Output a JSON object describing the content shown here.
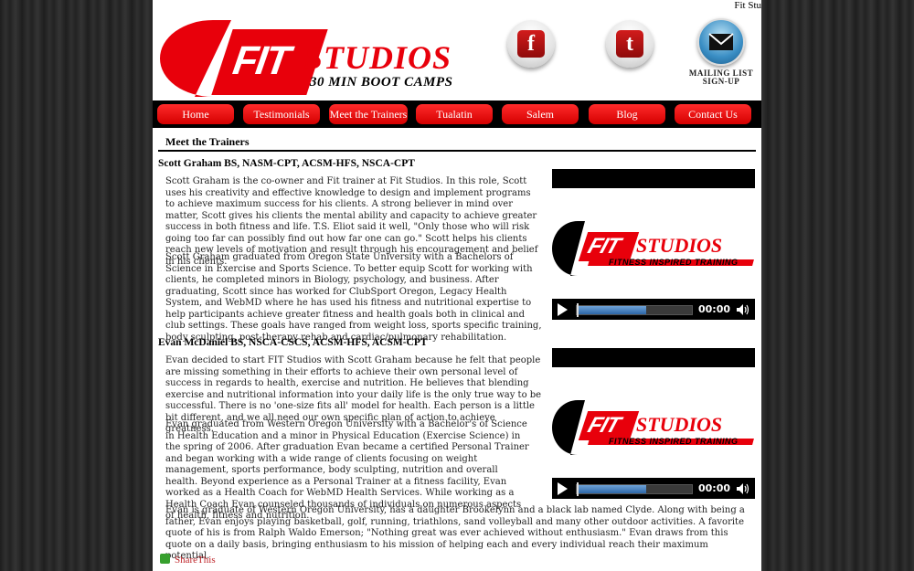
{
  "site": {
    "corner_text": "Fit Stu"
  },
  "header": {
    "logo_fit": "FIT",
    "logo_studios": "STUDIOS",
    "logo_tagline": "30 MIN BOOT CAMPS",
    "social": [
      {
        "name": "facebook",
        "glyph": "f",
        "icon": "facebook-icon"
      },
      {
        "name": "twitter",
        "glyph": "t",
        "icon": "twitter-icon"
      }
    ],
    "mailing_line1": "MAILING LIST",
    "mailing_line2": "SIGN-UP"
  },
  "nav": {
    "items": [
      {
        "label": "Home"
      },
      {
        "label": "Testimonials"
      },
      {
        "label": "Meet the Trainers"
      },
      {
        "label": "Tualatin"
      },
      {
        "label": "Salem"
      },
      {
        "label": "Blog"
      },
      {
        "label": "Contact Us"
      }
    ]
  },
  "content": {
    "page_title": "Meet the Trainers",
    "trainers": [
      {
        "name": "Scott Graham BS, NASM-CPT, ACSM-HFS, NSCA-CPT",
        "paragraphs": [
          "Scott Graham is the co-owner and Fit trainer at Fit Studios. In this role, Scott uses his creativity and effective knowledge to design and implement programs to achieve maximum success for his clients. A strong believer in mind over matter, Scott gives his clients the mental ability and capacity to achieve greater success in both fitness and life. T.S. Eliot said it well, \"Only those who will risk going too far can possibly find out how far one can go.\" Scott helps his clients reach new levels of motivation and result through his encouragement and belief in his clients.",
          "Scott Graham graduated from Oregon State University with a Bachelors of Science in Exercise and Sports Science. To better equip Scott for working with clients, he completed minors in Biology, psychology, and business. After graduating, Scott since has worked for ClubSport Oregon, Legacy Health System, and WebMD where he has used his fitness and nutritional expertise to help participants achieve greater fitness and health goals both in clinical and club settings. These goals have ranged from weight loss, sports specific training, body sculpting, post-therapy rehab and cardiac/pulmonary rehabilitation."
        ],
        "video": {
          "logo_fit": "FIT",
          "logo_studios": "STUDIOS",
          "logo_sub": "FITNESS INSPIRED TRAINING",
          "time": "00:00",
          "progress": 0.6
        }
      },
      {
        "name": "Evan McDaniel BS, NSCA-CSCS, ACSM-HFS, ACSM-CPT",
        "paragraphs": [
          "Evan decided to start FIT Studios with Scott Graham because he felt that people are missing something in their efforts to achieve their own personal level of success in regards to health, exercise and nutrition. He believes that blending exercise and nutritional information into your daily life is the only true way to be successful. There is no 'one-size fits all' model for health. Each person is a little bit different, and we all need our own specific plan of action to achieve greatness.",
          "Evan graduated from Western Oregon University with a Bachelor's of Science in Health Education and a minor in Physical Education (Exercise Science) in the spring of 2006. After graduation Evan became a certified Personal Trainer and began working with a wide range of clients focusing on weight management, sports performance, body sculpting, nutrition and overall health. Beyond experience as a Personal Trainer at a fitness facility, Evan worked as a Health Coach for WebMD Health Services. While working as a Health Coach Evan counseled thousands of individuals on numerous aspects of health, fitness and nutrition.",
          "Evan is graduate of Western Oregon University, has a daughter Brookelynn and a black lab named Clyde. Along with being a father, Evan enjoys playing basketball, golf, running, triathlons, sand volleyball and many other outdoor activities. A favorite quote of his is from Ralph Waldo Emerson; \"Nothing great was ever achieved without enthusiasm.\" Evan draws from this quote on a daily basis, bringing enthusiasm to his mission of helping each and every individual reach their maximum potential."
        ],
        "video": {
          "logo_fit": "FIT",
          "logo_studios": "STUDIOS",
          "logo_sub": "FITNESS INSPIRED TRAINING",
          "time": "00:00",
          "progress": 0.6
        }
      }
    ],
    "share_label": "ShareThis"
  },
  "colors": {
    "brand_red": "#e8000b",
    "nav_bar": "#000000",
    "share_text": "#c0282d"
  }
}
